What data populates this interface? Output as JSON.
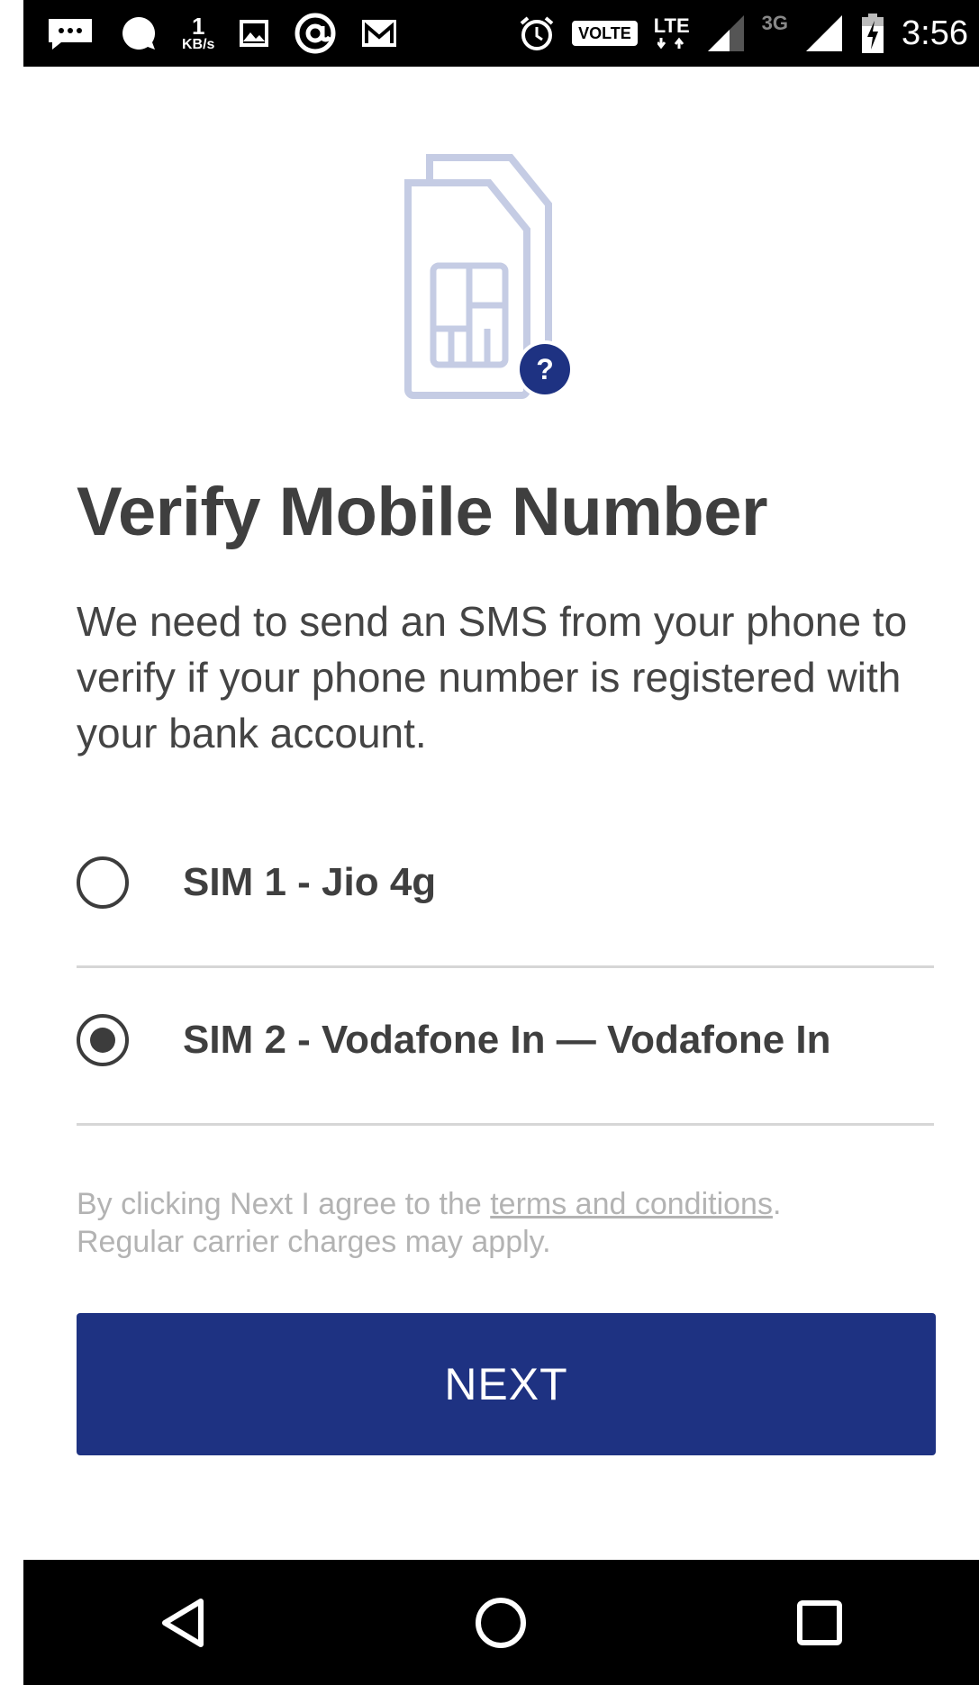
{
  "status_bar": {
    "data_rate_value": "1",
    "data_rate_unit": "KB/s",
    "volte": "VOLTE",
    "lte": "LTE",
    "network_3g": "3G",
    "time": "3:56",
    "icons": [
      "chat-icon",
      "messenger-icon",
      "gallery-icon",
      "at-icon",
      "gmail-icon",
      "alarm-icon",
      "signal-icon",
      "battery-charging-icon"
    ]
  },
  "illustration": {
    "icon": "sim-card-icon",
    "badge": "?",
    "colors": {
      "sim": "#c5cce4",
      "badge": "#1e3282"
    }
  },
  "title": "Verify Mobile Number",
  "description": "We need to send an SMS from your phone to verify if your phone number is registered with your bank account.",
  "sim_options": [
    {
      "label": "SIM 1 - Jio 4g",
      "selected": false
    },
    {
      "label": "SIM 2 - Vodafone In — Vodafone In",
      "selected": true
    }
  ],
  "terms": {
    "prefix": "By clicking Next I agree to the ",
    "link_text": "terms and conditions",
    "suffix": ".",
    "note": "Regular carrier charges may apply."
  },
  "next_button": {
    "label": "NEXT",
    "color": "#1e3282"
  },
  "nav_bar": {
    "icons": [
      "back-icon",
      "home-icon",
      "recents-icon"
    ]
  }
}
